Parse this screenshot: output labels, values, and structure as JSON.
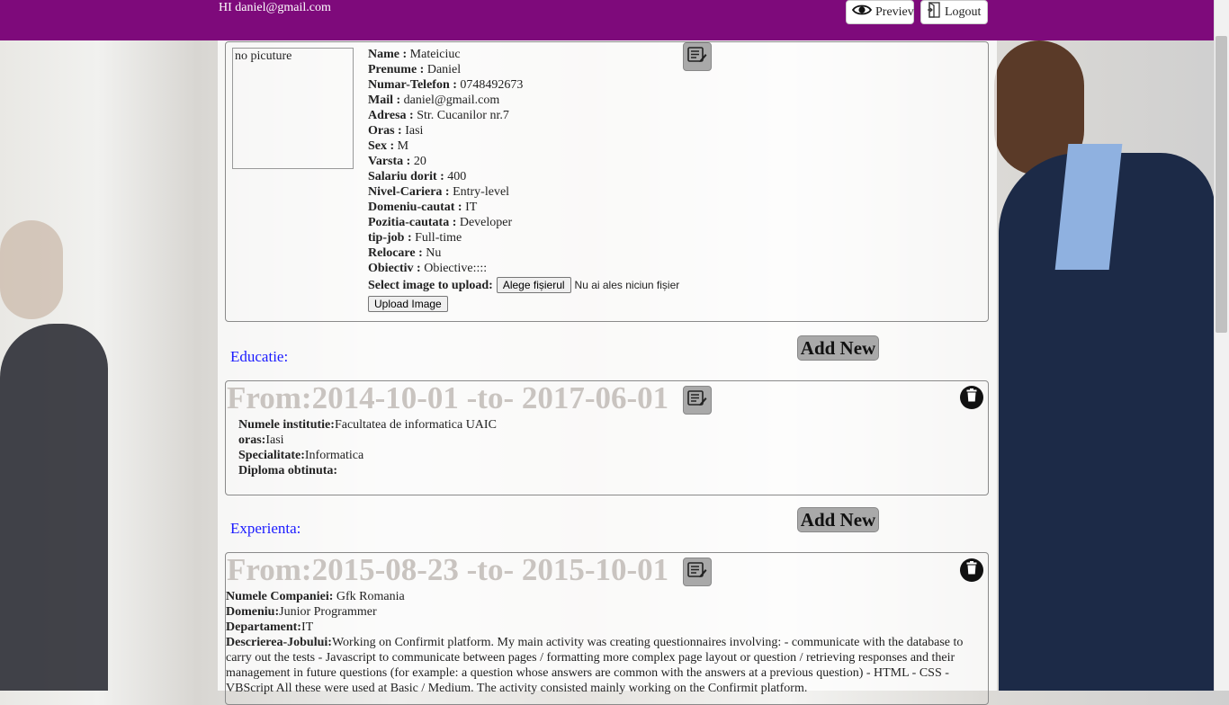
{
  "header": {
    "greeting": "HI daniel@gmail.com",
    "preview_label": "Previev",
    "logout_label": "Logout"
  },
  "profile": {
    "photo_alt": "no picuture",
    "fields": [
      {
        "label": "Name :",
        "value": "Mateiciuc"
      },
      {
        "label": "Prenume :",
        "value": "Daniel"
      },
      {
        "label": "Numar-Telefon :",
        "value": "0748492673"
      },
      {
        "label": "Mail :",
        "value": "daniel@gmail.com"
      },
      {
        "label": "Adresa :",
        "value": "Str. Cucanilor nr.7"
      },
      {
        "label": "Oras :",
        "value": "Iasi"
      },
      {
        "label": "Sex :",
        "value": "M"
      },
      {
        "label": "Varsta :",
        "value": "20"
      },
      {
        "label": "Salariu dorit :",
        "value": "400"
      },
      {
        "label": "Nivel-Cariera :",
        "value": "Entry-level"
      },
      {
        "label": "Domeniu-cautat :",
        "value": "IT"
      },
      {
        "label": "Pozitia-cautata :",
        "value": "Developer"
      },
      {
        "label": "tip-job :",
        "value": "Full-time"
      },
      {
        "label": "Relocare :",
        "value": "Nu"
      },
      {
        "label": "Obiectiv :",
        "value": "Obiective::::"
      }
    ],
    "upload_label": "Select image to upload:",
    "file_button": "Alege fișierul",
    "file_status": "Nu ai ales niciun fișier",
    "upload_button": "Upload Image"
  },
  "education": {
    "section_title": "Educatie:",
    "add_new_label": "Add New",
    "period": "From:2014-10-01 -to- 2017-06-01",
    "fields": [
      {
        "label": "Numele institutie:",
        "value": "Facultatea de informatica UAIC"
      },
      {
        "label": "oras:",
        "value": "Iasi"
      },
      {
        "label": "Specialitate:",
        "value": "Informatica"
      },
      {
        "label": "Diploma obtinuta:",
        "value": ""
      }
    ]
  },
  "experience": {
    "section_title": "Experienta:",
    "add_new_label": "Add New",
    "period": "From:2015-08-23 -to- 2015-10-01",
    "fields": [
      {
        "label": "Numele Companiei:",
        "value": " Gfk Romania"
      },
      {
        "label": "Domeniu:",
        "value": "Junior Programmer"
      },
      {
        "label": "Departament:",
        "value": "IT"
      },
      {
        "label": "Descrierea-Jobului:",
        "value": "Working on Confirmit platform. My main activity was creating questionnaires involving: - communicate with the database to carry out the tests - Javascript to communicate between pages / formatting more complex page layout or question / retrieving responses and their management in future questions (for example: a question whose answers are common with the answers at a previous question) - HTML - CSS - VBScript All these were used at Basic / Medium. The activity consisted mainly working on the Confirmit platform."
      }
    ]
  },
  "icons": {
    "edit": "edit-notes-icon",
    "delete": "trash-icon",
    "preview": "eye-icon",
    "logout": "logout-icon"
  },
  "colors": {
    "header_bg": "#7e0a7b",
    "section_title": "#1a1aff",
    "button_gray": "#a9a9a9"
  }
}
